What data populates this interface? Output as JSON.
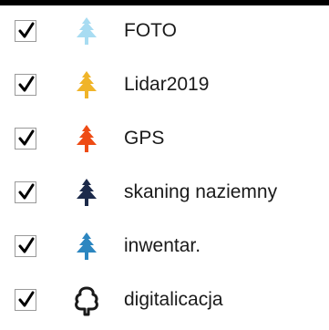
{
  "layers": [
    {
      "label": "FOTO",
      "checked": true,
      "icon": "tree-icon",
      "color": "#a8dcf2"
    },
    {
      "label": "Lidar2019",
      "checked": true,
      "icon": "tree-icon",
      "color": "#f0b429"
    },
    {
      "label": "GPS",
      "checked": true,
      "icon": "tree-icon",
      "color": "#ee4b14"
    },
    {
      "label": "skaning naziemny",
      "checked": true,
      "icon": "tree-icon",
      "color": "#1c2a4a"
    },
    {
      "label": "inwentar.",
      "checked": true,
      "icon": "tree-icon",
      "color": "#2c86c0"
    },
    {
      "label": "digitalicacja",
      "checked": true,
      "icon": "tree-outline-icon",
      "color": "#1a1a1a"
    }
  ]
}
